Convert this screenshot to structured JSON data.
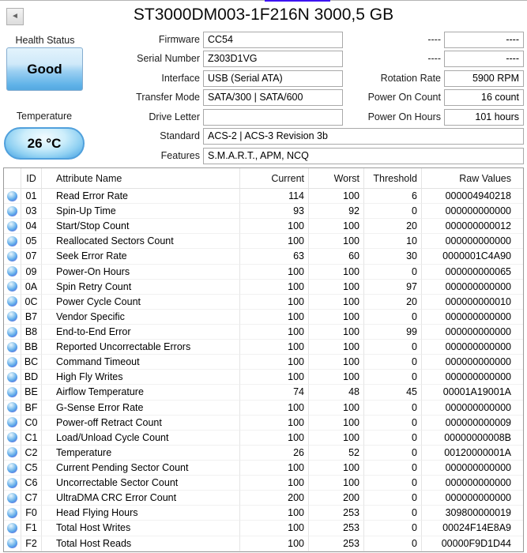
{
  "window": {
    "title": "ST3000DM003-1F216N 3000,5 GB"
  },
  "icons": {
    "back": "left-arrow-icon",
    "status_orb": "blue-orb-icon",
    "back_glyph": "◄"
  },
  "colors": {
    "accent_top_line": "#3d14f2",
    "health_good_button": "#5fb2e8",
    "temperature_pill": "#55abe6",
    "orb_blue": "#58a6ea"
  },
  "health": {
    "label": "Health Status",
    "status": "Good"
  },
  "temperature": {
    "label": "Temperature",
    "value": "26 °C"
  },
  "info_fields": {
    "left": [
      {
        "label": "Firmware",
        "value": "CC54"
      },
      {
        "label": "Serial Number",
        "value": "Z303D1VG"
      },
      {
        "label": "Interface",
        "value": "USB (Serial ATA)"
      },
      {
        "label": "Transfer Mode",
        "value": "SATA/300 | SATA/600"
      },
      {
        "label": "Drive Letter",
        "value": ""
      },
      {
        "label": "Standard",
        "value": "ACS-2 | ACS-3 Revision 3b"
      },
      {
        "label": "Features",
        "value": "S.M.A.R.T., APM, NCQ"
      }
    ],
    "right": [
      {
        "label": "----",
        "value": "----"
      },
      {
        "label": "----",
        "value": "----"
      },
      {
        "label": "Rotation Rate",
        "value": "5900 RPM"
      },
      {
        "label": "Power On Count",
        "value": "16 count"
      },
      {
        "label": "Power On Hours",
        "value": "101 hours"
      }
    ]
  },
  "table": {
    "header": {
      "id": "ID",
      "name": "Attribute Name",
      "current": "Current",
      "worst": "Worst",
      "threshold": "Threshold",
      "raw": "Raw Values"
    },
    "rows": [
      {
        "id": "01",
        "name": "Read Error Rate",
        "current": "114",
        "worst": "100",
        "threshold": "6",
        "raw": "000004940218"
      },
      {
        "id": "03",
        "name": "Spin-Up Time",
        "current": "93",
        "worst": "92",
        "threshold": "0",
        "raw": "000000000000"
      },
      {
        "id": "04",
        "name": "Start/Stop Count",
        "current": "100",
        "worst": "100",
        "threshold": "20",
        "raw": "000000000012"
      },
      {
        "id": "05",
        "name": "Reallocated Sectors Count",
        "current": "100",
        "worst": "100",
        "threshold": "10",
        "raw": "000000000000"
      },
      {
        "id": "07",
        "name": "Seek Error Rate",
        "current": "63",
        "worst": "60",
        "threshold": "30",
        "raw": "0000001C4A90"
      },
      {
        "id": "09",
        "name": "Power-On Hours",
        "current": "100",
        "worst": "100",
        "threshold": "0",
        "raw": "000000000065"
      },
      {
        "id": "0A",
        "name": "Spin Retry Count",
        "current": "100",
        "worst": "100",
        "threshold": "97",
        "raw": "000000000000"
      },
      {
        "id": "0C",
        "name": "Power Cycle Count",
        "current": "100",
        "worst": "100",
        "threshold": "20",
        "raw": "000000000010"
      },
      {
        "id": "B7",
        "name": "Vendor Specific",
        "current": "100",
        "worst": "100",
        "threshold": "0",
        "raw": "000000000000"
      },
      {
        "id": "B8",
        "name": "End-to-End Error",
        "current": "100",
        "worst": "100",
        "threshold": "99",
        "raw": "000000000000"
      },
      {
        "id": "BB",
        "name": "Reported Uncorrectable Errors",
        "current": "100",
        "worst": "100",
        "threshold": "0",
        "raw": "000000000000"
      },
      {
        "id": "BC",
        "name": "Command Timeout",
        "current": "100",
        "worst": "100",
        "threshold": "0",
        "raw": "000000000000"
      },
      {
        "id": "BD",
        "name": "High Fly Writes",
        "current": "100",
        "worst": "100",
        "threshold": "0",
        "raw": "000000000000"
      },
      {
        "id": "BE",
        "name": "Airflow Temperature",
        "current": "74",
        "worst": "48",
        "threshold": "45",
        "raw": "00001A19001A"
      },
      {
        "id": "BF",
        "name": "G-Sense Error Rate",
        "current": "100",
        "worst": "100",
        "threshold": "0",
        "raw": "000000000000"
      },
      {
        "id": "C0",
        "name": "Power-off Retract Count",
        "current": "100",
        "worst": "100",
        "threshold": "0",
        "raw": "000000000009"
      },
      {
        "id": "C1",
        "name": "Load/Unload Cycle Count",
        "current": "100",
        "worst": "100",
        "threshold": "0",
        "raw": "00000000008B"
      },
      {
        "id": "C2",
        "name": "Temperature",
        "current": "26",
        "worst": "52",
        "threshold": "0",
        "raw": "00120000001A"
      },
      {
        "id": "C5",
        "name": "Current Pending Sector Count",
        "current": "100",
        "worst": "100",
        "threshold": "0",
        "raw": "000000000000"
      },
      {
        "id": "C6",
        "name": "Uncorrectable Sector Count",
        "current": "100",
        "worst": "100",
        "threshold": "0",
        "raw": "000000000000"
      },
      {
        "id": "C7",
        "name": "UltraDMA CRC Error Count",
        "current": "200",
        "worst": "200",
        "threshold": "0",
        "raw": "000000000000"
      },
      {
        "id": "F0",
        "name": "Head Flying Hours",
        "current": "100",
        "worst": "253",
        "threshold": "0",
        "raw": "309800000019"
      },
      {
        "id": "F1",
        "name": "Total Host Writes",
        "current": "100",
        "worst": "253",
        "threshold": "0",
        "raw": "00024F14E8A9"
      },
      {
        "id": "F2",
        "name": "Total Host Reads",
        "current": "100",
        "worst": "253",
        "threshold": "0",
        "raw": "00000F9D1D44"
      }
    ]
  }
}
